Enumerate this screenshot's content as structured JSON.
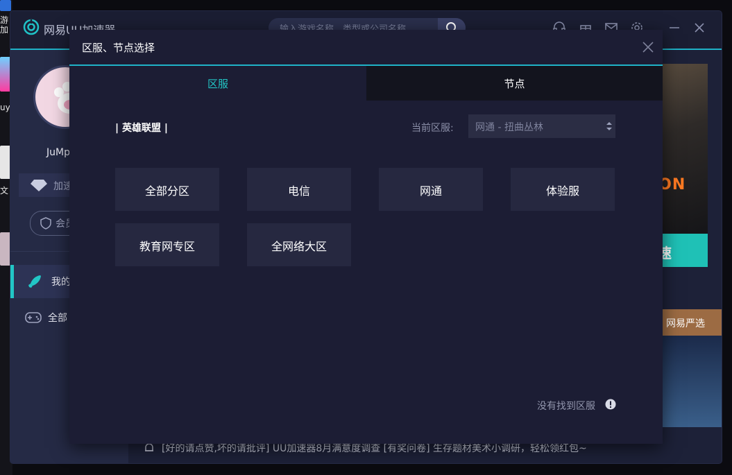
{
  "desktop": {
    "labels": [
      "游加",
      "uy",
      "文"
    ]
  },
  "app": {
    "title": "网易UU加速器",
    "search_placeholder": "输入游戏名称、类型或公司名称"
  },
  "sidebar": {
    "username": "JuMp",
    "vip_label": "加速",
    "member_label": "会员",
    "nav_my": "我的",
    "nav_all": "全部"
  },
  "banner": {
    "game_logo": "ION",
    "button_label": "速"
  },
  "ad": {
    "label": "网易严选"
  },
  "notice": {
    "text": "[好的请点赞,坏的请批评] UU加速器8月满意度调查    [有奖问卷] 生存题材美术小调研，轻松领红包~"
  },
  "dialog": {
    "title": "区服、节点选择",
    "tabs": [
      "区服",
      "节点"
    ],
    "game_label": "| 英雄联盟 |",
    "current_label": "当前区服:",
    "current_value": "网通 - 扭曲丛林",
    "regions": [
      "全部分区",
      "电信",
      "网通",
      "体验服",
      "教育网专区",
      "全网络大区"
    ],
    "not_found": "没有找到区服"
  },
  "colors": {
    "accent": "#1fb3c8",
    "teal_button": "#1fc1b6",
    "dialog_bg": "#1c1d34",
    "region_btn_bg": "#262840"
  }
}
